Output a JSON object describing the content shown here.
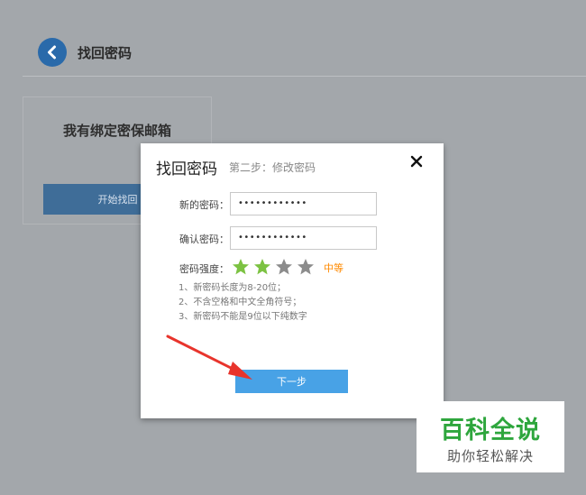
{
  "header": {
    "title": "找回密码",
    "back_icon": "chevron-left-icon"
  },
  "bg_card": {
    "title": "我有绑定密保邮箱",
    "button_label": "开始找回"
  },
  "modal": {
    "title": "找回密码",
    "subtitle": "第二步：修改密码",
    "close_icon": "close-icon",
    "new_password_label": "新的密码：",
    "new_password_value": "••••••••••••",
    "confirm_password_label": "确认密码：",
    "confirm_password_value": "••••••••••••",
    "strength_label": "密码强度：",
    "strength_stars_filled": 2,
    "strength_stars_total": 4,
    "strength_text": "中等",
    "rules": [
      "1、新密码长度为8-20位；",
      "2、不含空格和中文全角符号；",
      "3、新密码不能是9位以下纯数字"
    ],
    "next_button_label": "下一步"
  },
  "watermark": {
    "main": "百科全说",
    "sub": "助你轻松解决"
  },
  "colors": {
    "accent": "#48a2e6",
    "star_filled": "#7cc242",
    "star_empty": "#8c8c8c",
    "strength": "#ff8a00",
    "arrow": "#e8342c",
    "watermark": "#2ea63d"
  }
}
